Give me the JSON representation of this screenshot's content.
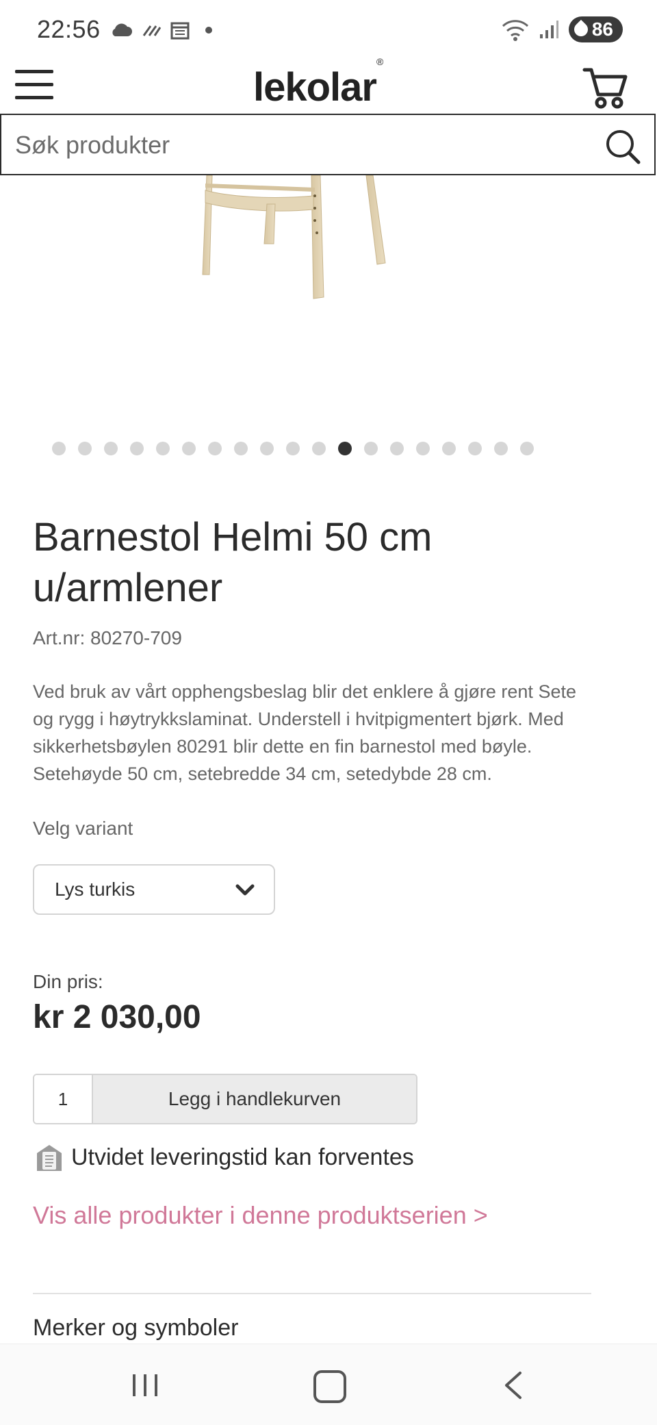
{
  "status_bar": {
    "time": "22:56",
    "battery": "86"
  },
  "header": {
    "logo": "lekolar",
    "logo_mark": "®"
  },
  "search": {
    "placeholder": "Søk produkter"
  },
  "carousel": {
    "dot_count": 19,
    "active_index": 11
  },
  "product": {
    "title": "Barnestol Helmi 50 cm u/armlener",
    "art_nr": "Art.nr: 80270-709",
    "description": "Ved bruk av vårt opphengsbeslag blir det enklere å gjøre rent Sete og rygg i høytrykkslaminat. Understell i hvitpigmentert bjørk. Med sikkerhetsbøylen 80291 blir dette en fin barnestol med bøyle. Setehøyde 50 cm, setebredde 34 cm, setedybde 28 cm.",
    "variant_label": "Velg variant",
    "variant_value": "Lys turkis",
    "price_label": "Din pris:",
    "price": "kr 2 030,00",
    "quantity": "1",
    "add_to_cart": "Legg i handlekurven",
    "delivery_notice": "Utvidet leveringstid kan forventes",
    "series_link": "Vis alle produkter i denne produktserien >",
    "section_title": "Merker og symboler"
  },
  "colors": {
    "link": "#d07898",
    "text": "#2b2b2b",
    "muted": "#666666",
    "dot_active": "#333333",
    "dot_inactive": "#d6d6d6"
  }
}
